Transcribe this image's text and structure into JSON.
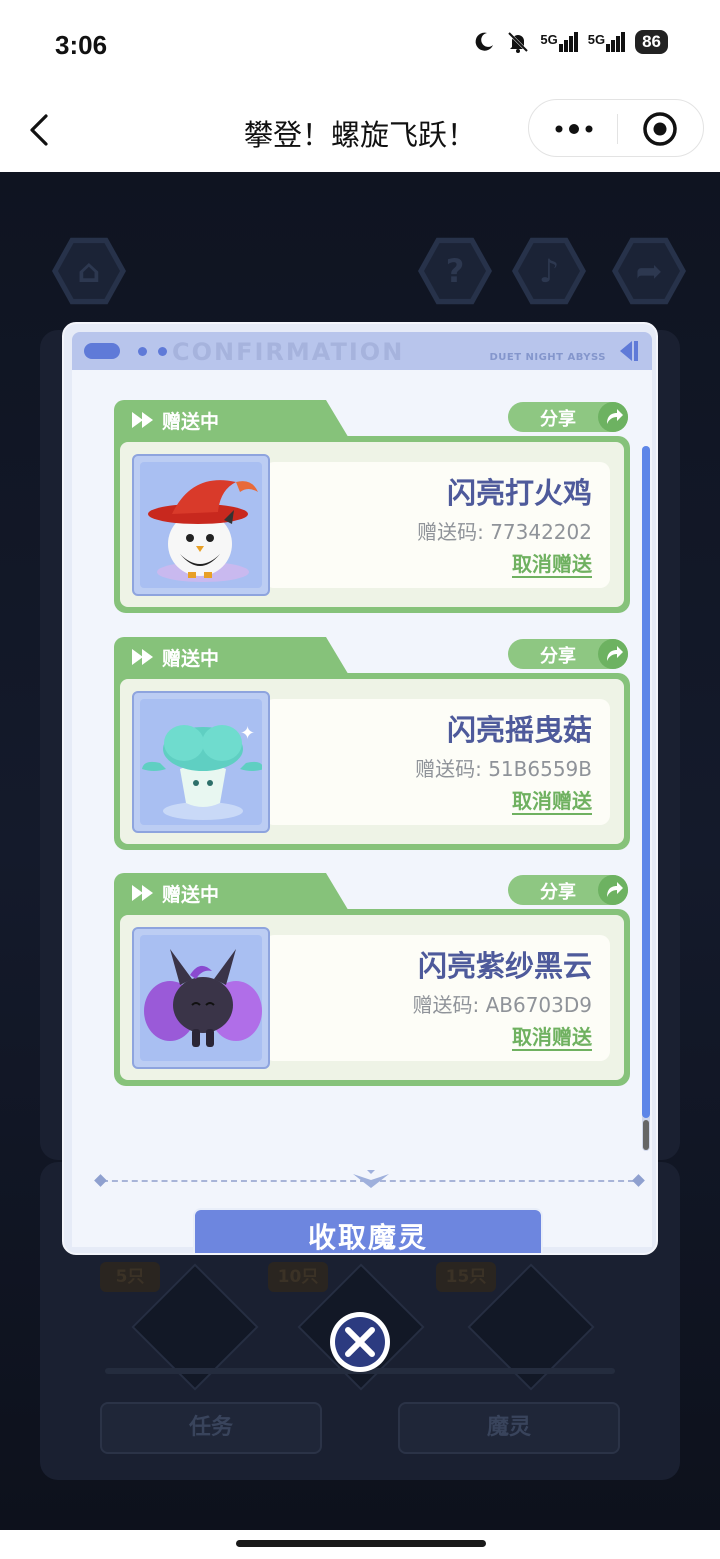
{
  "status_bar": {
    "time": "3:06",
    "battery": "86",
    "network_1": "5G",
    "network_2": "5G",
    "icons": [
      "moon-icon",
      "mute-bell-icon",
      "signal-icon",
      "signal-icon",
      "battery-icon"
    ]
  },
  "title_bar": {
    "title": "攀登！螺旋飞跃！",
    "icons": [
      "back-icon",
      "more-icon",
      "target-icon"
    ]
  },
  "modal": {
    "header_brand": "DUET NIGHT ABYSS",
    "header_ghost_text": "CONFIRMATION",
    "cards": [
      {
        "status": "赠送中",
        "share_label": "分享",
        "pet_name": "闪亮打火鸡",
        "gift_code": "赠送码: 77342202",
        "cancel_label": "取消赠送"
      },
      {
        "status": "赠送中",
        "share_label": "分享",
        "pet_name": "闪亮摇曳菇",
        "gift_code": "赠送码: 51B6559B",
        "cancel_label": "取消赠送"
      },
      {
        "status": "赠送中",
        "share_label": "分享",
        "pet_name": "闪亮紫纱黑云",
        "gift_code": "赠送码: AB6703D9",
        "cancel_label": "取消赠送"
      }
    ],
    "collect_button": "收取魔灵"
  },
  "background": {
    "counts": [
      "5只",
      "10只",
      "15只"
    ],
    "task_button": "任务",
    "pet_button": "魔灵"
  },
  "colors": {
    "accent_blue": "#6d86df",
    "card_green": "#86c27a",
    "pet_name": "#4e5a9b",
    "cancel_green": "#6fb160"
  }
}
